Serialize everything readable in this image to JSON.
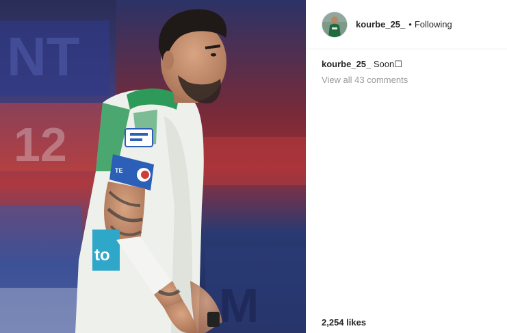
{
  "post": {
    "username": "kourbe_25_",
    "separator": "•",
    "follow_status": "Following",
    "caption_user": "kourbe_25_",
    "caption_text": "Soon☐",
    "view_comments_label": "View all 43 comments",
    "likes": "2,254 likes"
  },
  "photo": {
    "shirt_text": "to",
    "armband_text": "ΤΕ"
  },
  "colors": {
    "jersey_white": "#eef0ec",
    "jersey_green": "#2e9a5a",
    "armband_blue": "#2b5fb8",
    "skin": "#c49070",
    "hair": "#1f1a17"
  }
}
